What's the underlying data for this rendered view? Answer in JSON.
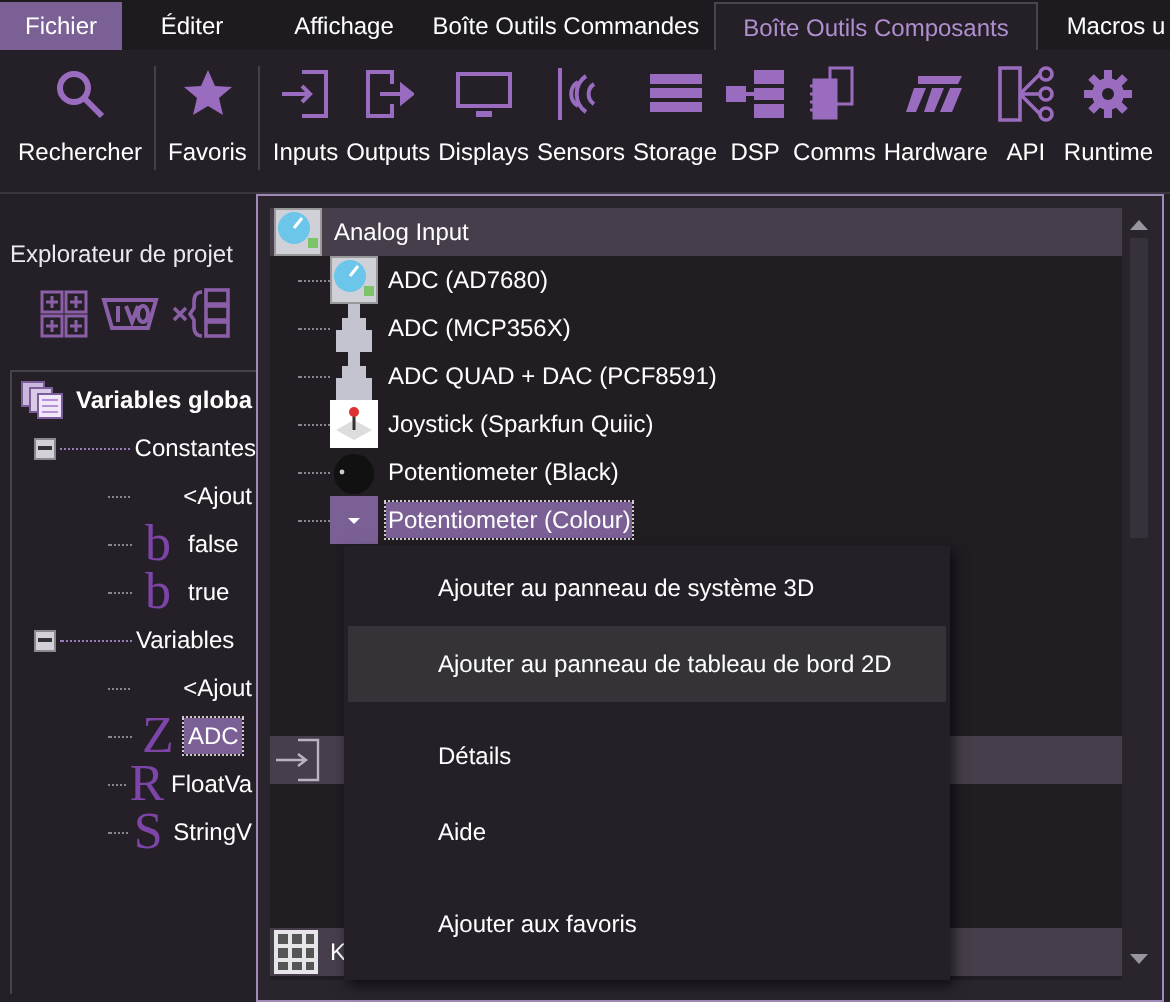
{
  "menu_tabs": [
    {
      "label": "Fichier",
      "selected": false,
      "kind": "file"
    },
    {
      "label": "Éditer",
      "selected": false,
      "kind": "tab"
    },
    {
      "label": "Affichage",
      "selected": false,
      "kind": "tab"
    },
    {
      "label": "Boîte Outils Commandes",
      "selected": false,
      "kind": "tab"
    },
    {
      "label": "Boîte Outils Composants",
      "selected": true,
      "kind": "tab"
    },
    {
      "label": "Macros u",
      "selected": false,
      "kind": "tab"
    }
  ],
  "toolbar": [
    {
      "label": "Rechercher",
      "separator_after": true
    },
    {
      "label": "Favoris",
      "separator_after": true
    },
    {
      "label": "Inputs",
      "separator_after": false
    },
    {
      "label": "Outputs",
      "separator_after": false
    },
    {
      "label": "Displays",
      "separator_after": false
    },
    {
      "label": "Sensors",
      "separator_after": false
    },
    {
      "label": "Storage",
      "separator_after": false
    },
    {
      "label": "DSP",
      "separator_after": false
    },
    {
      "label": "Comms",
      "separator_after": false
    },
    {
      "label": "Hardware",
      "separator_after": false
    },
    {
      "label": "API",
      "separator_after": false
    },
    {
      "label": "Runtime",
      "separator_after": false
    }
  ],
  "explorer": {
    "title": "Explorateur de projet",
    "tree": {
      "label": "Variables globa",
      "children": [
        {
          "label": "Constantes",
          "expanded": true,
          "children": [
            {
              "label": "<Ajout",
              "selected": false
            },
            {
              "label": "false",
              "glyph": "b",
              "selected": false
            },
            {
              "label": "true",
              "glyph": "b",
              "selected": false
            }
          ]
        },
        {
          "label": "Variables",
          "expanded": true,
          "children": [
            {
              "label": "<Ajout",
              "selected": false
            },
            {
              "label": "ADC",
              "glyph": "Z",
              "selected": true
            },
            {
              "label": "FloatVa",
              "glyph": "R",
              "selected": false
            },
            {
              "label": "StringV",
              "glyph": "S",
              "selected": false
            }
          ]
        }
      ]
    }
  },
  "component_panel": {
    "categories": [
      {
        "label": "Analog Input",
        "items": [
          {
            "label": "ADC (AD7680)",
            "selected": false
          },
          {
            "label": "ADC (MCP356X)",
            "selected": false
          },
          {
            "label": "ADC QUAD + DAC (PCF8591)",
            "selected": false
          },
          {
            "label": "Joystick (Sparkfun Quiic)",
            "selected": false
          },
          {
            "label": "Potentiometer (Black)",
            "selected": false
          },
          {
            "label": "Potentiometer (Colour)",
            "selected": true
          }
        ]
      },
      {
        "kind": "input"
      },
      {
        "label": "K",
        "kind": "keypad"
      }
    ]
  },
  "context_menu": [
    {
      "label": "Ajouter au panneau de système 3D",
      "selected": false
    },
    {
      "label": "Ajouter au panneau de tableau de bord 2D",
      "selected": true
    },
    {
      "label": "Détails",
      "selected": false
    },
    {
      "label": "Aide",
      "selected": false
    },
    {
      "label": "Ajouter aux favoris",
      "selected": false
    }
  ]
}
